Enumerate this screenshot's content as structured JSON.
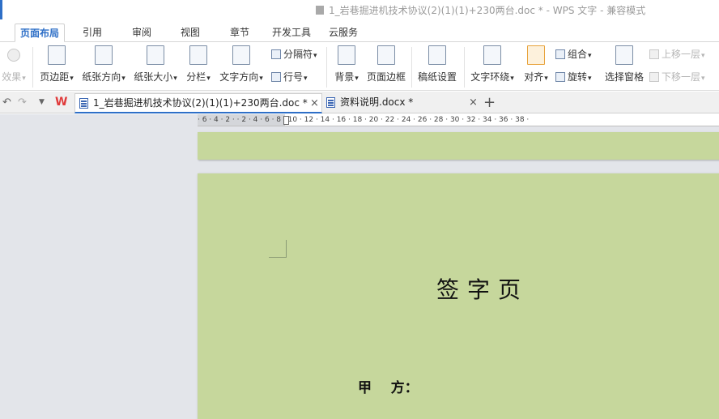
{
  "window": {
    "title": "1_岩巷掘进机技术协议(2)(1)(1)+230两台.doc * - WPS 文字 - 兼容模式"
  },
  "ribbon_tabs": [
    {
      "label": "页面布局",
      "active": true
    },
    {
      "label": "引用"
    },
    {
      "label": "审阅"
    },
    {
      "label": "视图"
    },
    {
      "label": "章节"
    },
    {
      "label": "开发工具"
    },
    {
      "label": "云服务"
    }
  ],
  "ribbon": {
    "effects": "效果",
    "margins": "页边距",
    "orientation": "纸张方向",
    "paper_size": "纸张大小",
    "columns": "分栏",
    "text_direction": "文字方向",
    "separator": "分隔符",
    "line_numbers": "行号",
    "background": "背景",
    "page_border": "页面边框",
    "draft_paper": "稿纸设置",
    "wrap_text": "文字环绕",
    "align": "对齐",
    "group": "组合",
    "rotate": "旋转",
    "selection_pane": "选择窗格",
    "bring_forward": "上移一层",
    "send_backward": "下移一层"
  },
  "doc_tabs": [
    {
      "label": "1_岩巷掘进机技术协议(2)(1)(1)+230两台.doc *",
      "active": true
    },
    {
      "label": "资料说明.docx *"
    }
  ],
  "ruler": {
    "ticks": "· 6 · 4 · 2 ·   · 2 · 4 · 6 · 8 · 10 · 12 · 14 · 16 · 18 · 20 · 22 · 24 · 26 · 28 · 30 · 32 · 34 · 36 · 38 ·"
  },
  "document": {
    "heading": "签字页",
    "party_a": "甲    方："
  },
  "colors": {
    "accent": "#2e6fc7",
    "page_background": "#c6d79c"
  }
}
